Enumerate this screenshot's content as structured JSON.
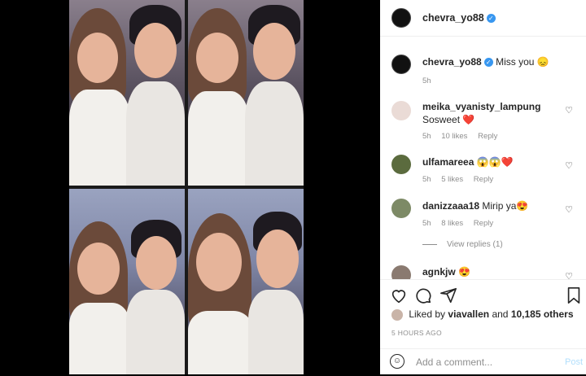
{
  "header": {
    "username": "chevra_yo88"
  },
  "caption": {
    "username": "chevra_yo88",
    "text": "Miss you 😞",
    "time": "5h"
  },
  "comments": [
    {
      "username": "meika_vyanisty_lampung",
      "text": "Sosweet ❤️",
      "time": "5h",
      "likes": "10 likes",
      "reply": "Reply"
    },
    {
      "username": "ulfamareea",
      "text": "😱😱❤️",
      "time": "5h",
      "likes": "5 likes",
      "reply": "Reply"
    },
    {
      "username": "danizzaaa18",
      "text": "Mirip ya😍",
      "time": "5h",
      "likes": "8 likes",
      "reply": "Reply",
      "view_replies": "View replies (1)"
    },
    {
      "username": "agnkjw",
      "text": "😍"
    }
  ],
  "likes": {
    "prefix": "Liked by",
    "user": "viavallen",
    "middle": "and",
    "count": "10,185 others"
  },
  "timestamp": "5 HOURS AGO",
  "add_comment": {
    "placeholder": "Add a comment...",
    "post_label": "Post"
  },
  "icons": [
    "heart-icon",
    "comment-icon",
    "share-icon",
    "bookmark-icon",
    "emoji-icon",
    "verified-icon"
  ],
  "colors": {
    "verified": "#3897f0",
    "heart_red": "#ed4956",
    "post_disabled": "#b2dffc"
  }
}
